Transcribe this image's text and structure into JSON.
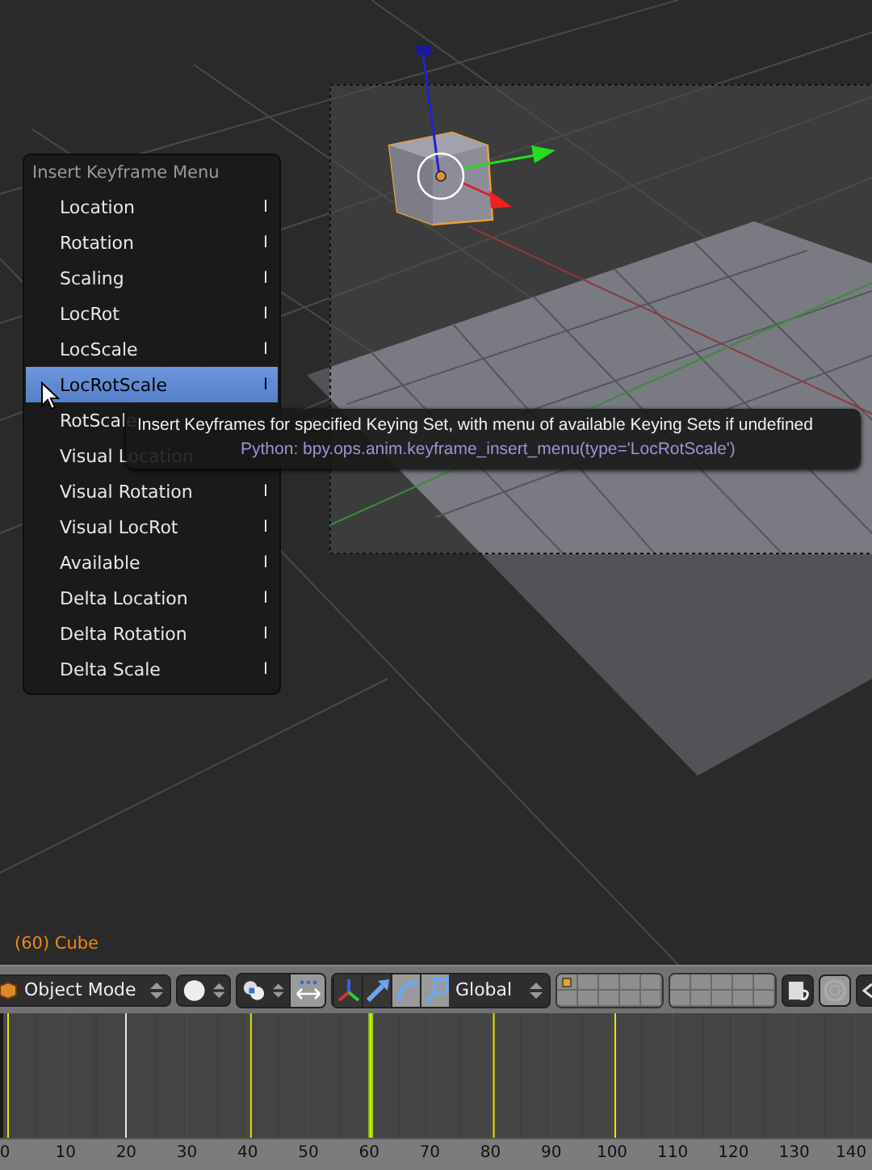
{
  "viewport": {
    "status": "(60) Cube"
  },
  "menu": {
    "title": "Insert Keyframe Menu",
    "items": [
      {
        "label": "Location",
        "shortcut": "I",
        "selected": false
      },
      {
        "label": "Rotation",
        "shortcut": "I",
        "selected": false
      },
      {
        "label": "Scaling",
        "shortcut": "I",
        "selected": false
      },
      {
        "label": "LocRot",
        "shortcut": "I",
        "selected": false
      },
      {
        "label": "LocScale",
        "shortcut": "I",
        "selected": false
      },
      {
        "label": "LocRotScale",
        "shortcut": "I",
        "selected": true
      },
      {
        "label": "RotScale",
        "selected": false
      },
      {
        "label": "Visual Location",
        "selected": false
      },
      {
        "label": "Visual Rotation",
        "shortcut": "I",
        "selected": false
      },
      {
        "label": "Visual LocRot",
        "shortcut": "I",
        "selected": false
      },
      {
        "label": "Available",
        "shortcut": "I",
        "selected": false
      },
      {
        "label": "Delta Location",
        "shortcut": "I",
        "selected": false
      },
      {
        "label": "Delta Rotation",
        "shortcut": "I",
        "selected": false
      },
      {
        "label": "Delta Scale",
        "shortcut": "I",
        "selected": false
      }
    ]
  },
  "tooltip": {
    "description": "Insert Keyframes for specified Keying Set, with menu of available Keying Sets if undefined",
    "python": "Python: bpy.ops.anim.keyframe_insert_menu(type='LocRotScale')"
  },
  "header": {
    "mode": "Object Mode",
    "orientation": "Global",
    "manipulators": [
      {
        "kind": "toggle",
        "on": true
      },
      {
        "kind": "translate",
        "on": true
      },
      {
        "kind": "rotate",
        "on": false
      },
      {
        "kind": "scale",
        "on": false
      }
    ],
    "layers": [
      {
        "has_objects": true
      },
      {
        "has_objects": false
      },
      {
        "has_objects": false
      },
      {
        "has_objects": false
      },
      {
        "has_objects": false
      },
      {
        "has_objects": false
      },
      {
        "has_objects": false
      },
      {
        "has_objects": false
      },
      {
        "has_objects": false
      },
      {
        "has_objects": false
      },
      {
        "has_objects": false
      },
      {
        "has_objects": false
      },
      {
        "has_objects": false
      },
      {
        "has_objects": false
      },
      {
        "has_objects": false
      },
      {
        "has_objects": false
      },
      {
        "has_objects": false
      },
      {
        "has_objects": false
      },
      {
        "has_objects": false
      },
      {
        "has_objects": false
      }
    ]
  },
  "timeline": {
    "ruler": [
      "0",
      "10",
      "20",
      "30",
      "40",
      "50",
      "60",
      "70",
      "80",
      "90",
      "100",
      "110",
      "120",
      "130",
      "140"
    ]
  }
}
